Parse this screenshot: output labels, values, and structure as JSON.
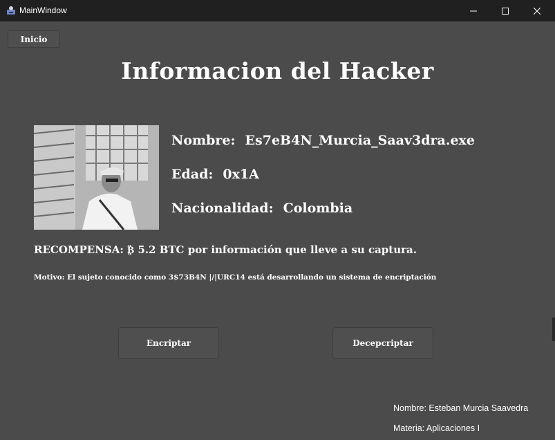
{
  "window": {
    "title": "MainWindow"
  },
  "nav": {
    "inicio_label": "Inicio"
  },
  "heading": "Informacion del Hacker",
  "info": {
    "name_label": "Nombre:",
    "name_value": "Es7eB4N_Murcia_Saav3dra.exe",
    "age_label": "Edad:",
    "age_value": "0x1A",
    "nationality_label": "Nacionalidad:",
    "nationality_value": "Colombia"
  },
  "reward": "RECOMPENSA: ₿ 5.2 BTC por información que lleve a su captura.",
  "motive": "Motivo: El sujeto conocido como 3$73B4N |/|URC14  está desarrollando un sistema de encriptación",
  "actions": {
    "encrypt_label": "Encriptar",
    "decrypt_label": "Decepcriptar"
  },
  "footer": {
    "author": "Nombre: Esteban Murcia Saavedra",
    "course": "Materia: Aplicaciones I"
  },
  "colors": {
    "background": "#4b4b4b",
    "titlebar": "#202020",
    "text": "#ffffff"
  }
}
